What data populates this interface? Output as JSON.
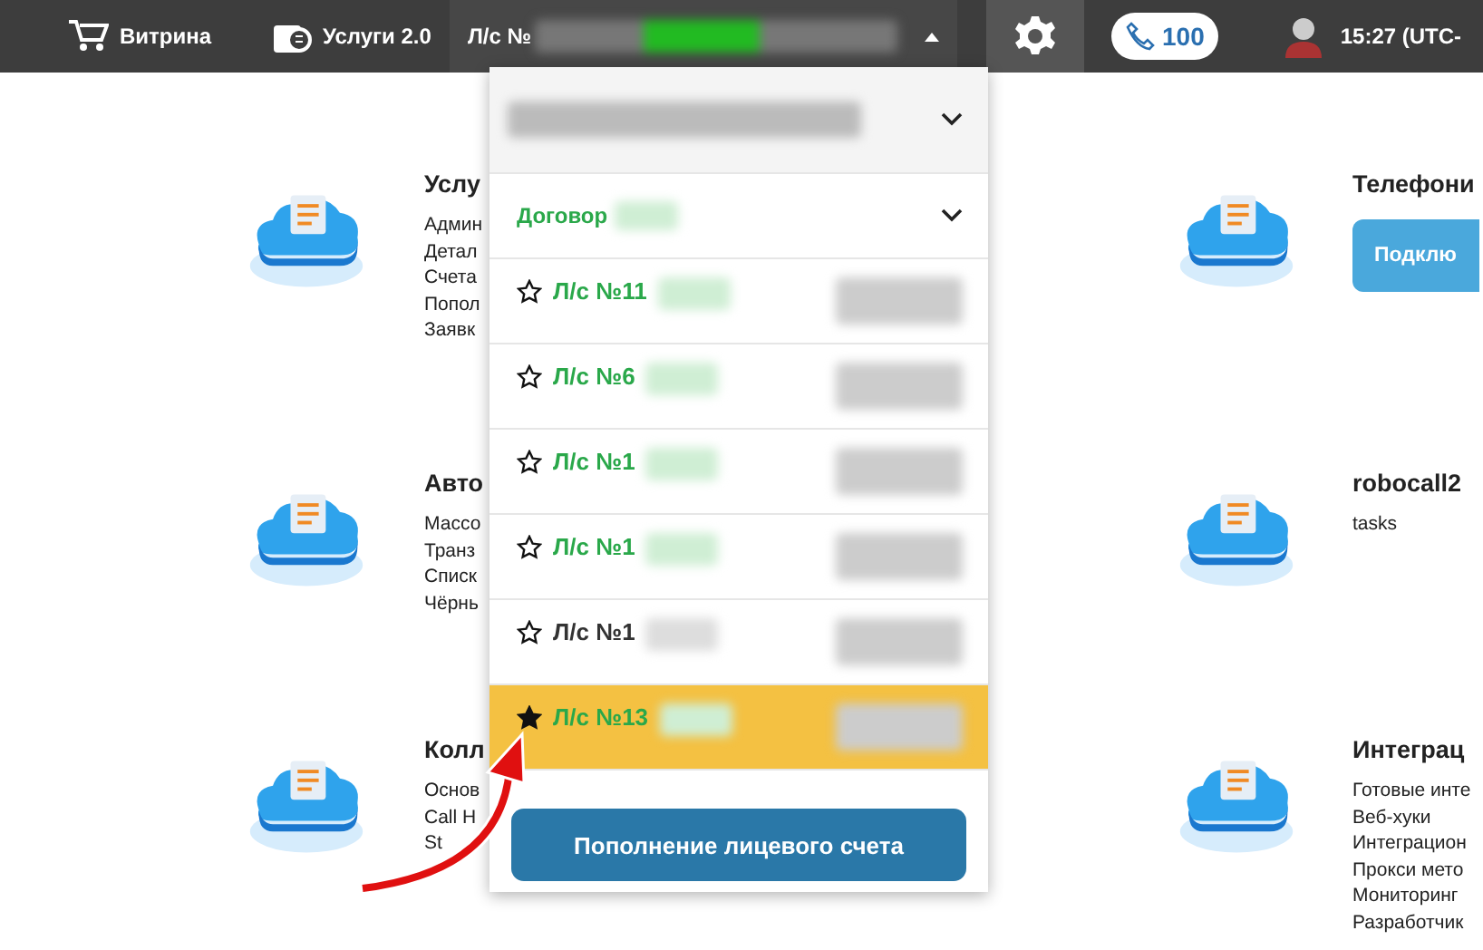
{
  "top_bar": {
    "nav": [
      {
        "kind": "cart",
        "label": "Витрина"
      },
      {
        "kind": "wallet",
        "label": "Услуги 2.0"
      }
    ],
    "account_selector": {
      "label": "Л/с №",
      "expanded": true
    },
    "calls": {
      "count": "100"
    },
    "clock": "15:27 (UTC-"
  },
  "services_left": [
    {
      "title": "Услу",
      "items": [
        "Админ",
        "Детал",
        "Счета",
        "Попол",
        "Заявк"
      ]
    },
    {
      "title": "Авто",
      "items": [
        "Массо",
        "Транз",
        "Списк",
        "Чёрнь"
      ]
    },
    {
      "title": "Колл",
      "items": [
        "Основ",
        "Call H",
        "St"
      ]
    }
  ],
  "services_right": [
    {
      "title": "Телефони",
      "button": "Подклю"
    },
    {
      "title": "robocall2",
      "items": [
        "tasks"
      ]
    },
    {
      "title": "Интеграц",
      "items": [
        "Готовые инте",
        "Веб-хуки",
        "Интеграцион",
        "Прокси мето",
        "Мониторинг",
        "Разработчик"
      ]
    }
  ],
  "dropdown": {
    "contract": "Договор",
    "accounts": [
      {
        "label": "Л/с №11",
        "active": true,
        "starred": false,
        "selected": false
      },
      {
        "label": "Л/с №6",
        "active": true,
        "starred": false,
        "selected": false
      },
      {
        "label": "Л/с №1",
        "active": true,
        "starred": false,
        "selected": false
      },
      {
        "label": "Л/с №1",
        "active": true,
        "starred": false,
        "selected": false
      },
      {
        "label": "Л/с №1",
        "active": false,
        "starred": false,
        "selected": false
      },
      {
        "label": "Л/с №13",
        "active": true,
        "starred": true,
        "selected": true
      }
    ],
    "button": "Пополнение лицевого счета"
  }
}
